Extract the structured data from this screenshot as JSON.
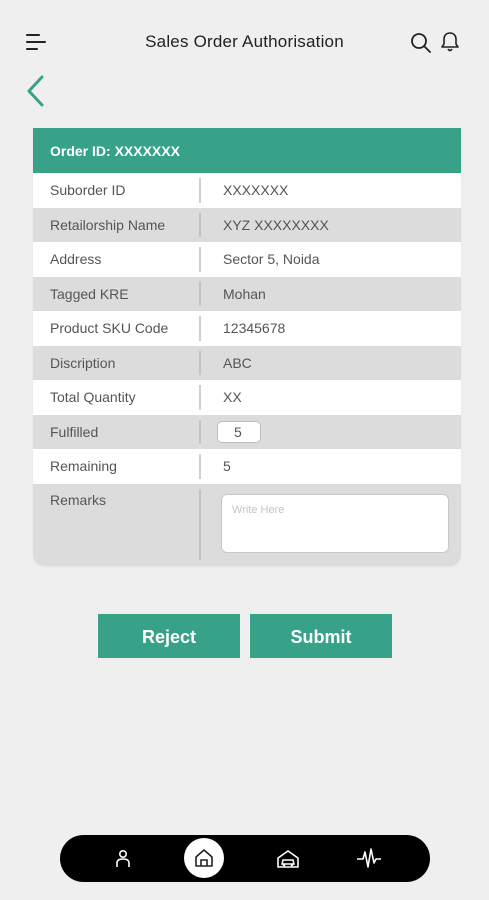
{
  "header": {
    "title": "Sales Order Authorisation",
    "icons": [
      "menu-icon",
      "search-icon",
      "bell-icon",
      "back-arrow-icon"
    ]
  },
  "order": {
    "header_label": "Order ID: XXXXXXX",
    "rows": [
      {
        "label": "Suborder ID",
        "value": "XXXXXXX"
      },
      {
        "label": "Retailorship Name",
        "value": "XYZ XXXXXXXX"
      },
      {
        "label": "Address",
        "value": "Sector 5, Noida"
      },
      {
        "label": "Tagged KRE",
        "value": "Mohan"
      },
      {
        "label": "Product SKU Code",
        "value": "12345678"
      },
      {
        "label": "Discription",
        "value": "ABC"
      },
      {
        "label": "Total Quantity",
        "value": "XX"
      }
    ],
    "fulfilled": {
      "label": "Fulfilled",
      "value": "5"
    },
    "remaining": {
      "label": "Remaining",
      "value": "5"
    },
    "remarks": {
      "label": "Remarks",
      "placeholder": "Write Here",
      "value": ""
    }
  },
  "actions": {
    "reject_label": "Reject",
    "submit_label": "Submit"
  },
  "bottom_nav": {
    "items": [
      "person-icon",
      "home-icon",
      "car-icon",
      "activity-icon"
    ],
    "active": "home-icon"
  },
  "colors": {
    "accent": "#37a287",
    "background": "#efefef",
    "nav_bg": "#000000"
  }
}
